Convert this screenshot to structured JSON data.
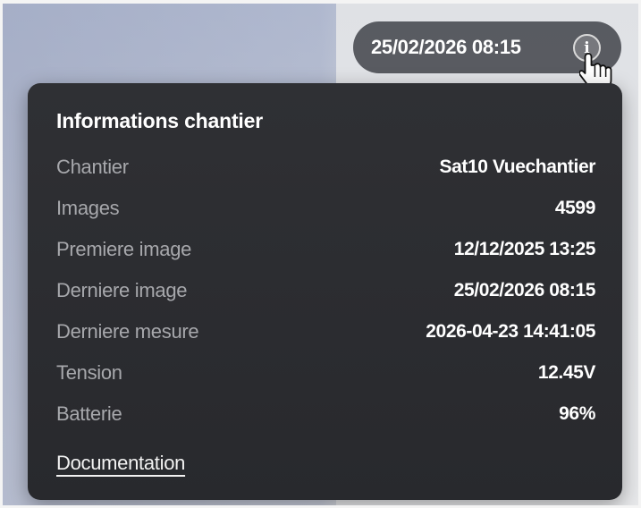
{
  "header": {
    "datetime": "25/02/2026 08:15",
    "info_icon_glyph": "i"
  },
  "panel": {
    "title": "Informations chantier",
    "rows": [
      {
        "label": "Chantier",
        "value": "Sat10 Vuechantier"
      },
      {
        "label": "Images",
        "value": "4599"
      },
      {
        "label": "Premiere image",
        "value": "12/12/2025 13:25"
      },
      {
        "label": "Derniere image",
        "value": "25/02/2026 08:15"
      },
      {
        "label": "Derniere mesure",
        "value": "2026-04-23 14:41:05"
      },
      {
        "label": "Tension",
        "value": "12.45V"
      },
      {
        "label": "Batterie",
        "value": "96%"
      }
    ],
    "documentation_link": "Documentation"
  },
  "icons": {
    "info": "info-icon",
    "cursor": "hand-pointer-icon"
  },
  "colors": {
    "panel_background": "#2d2e32",
    "label_text": "#a7a8ac",
    "value_text": "#ffffff"
  }
}
